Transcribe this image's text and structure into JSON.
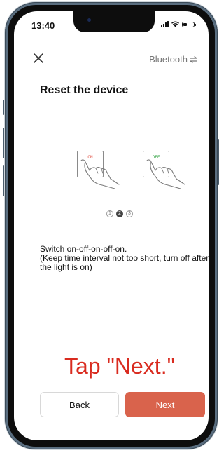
{
  "status_bar": {
    "time": "13:40"
  },
  "header": {
    "close_icon": "close-icon",
    "mode_label": "Bluetooth",
    "mode_icon": "swap-arrows-icon"
  },
  "page_title": "Reset the device",
  "illustrations": [
    {
      "switch_label": "ON",
      "icon": "finger-press-switch-icon"
    },
    {
      "switch_label": "OFF",
      "icon": "finger-press-switch-icon"
    }
  ],
  "pager": {
    "pages": [
      "1",
      "2",
      "3"
    ],
    "current": 2
  },
  "instruction": {
    "line1": "Switch on-off-on-off-on.",
    "line2": "(Keep time interval not too short, turn off after the light is on)"
  },
  "overlay_hint": "Tap \"Next.\"",
  "buttons": {
    "back": "Back",
    "next": "Next"
  },
  "colors": {
    "accent": "#d9634c",
    "hint": "#d92b1f",
    "switch_on": "#e0473a",
    "switch_off": "#3aa64a"
  }
}
